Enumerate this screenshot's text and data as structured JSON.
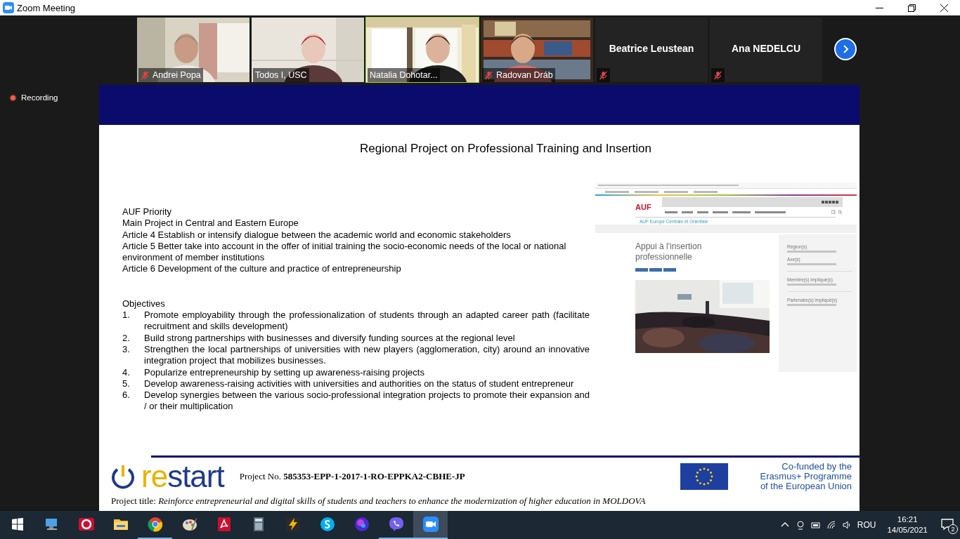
{
  "window": {
    "title": "Zoom Meeting"
  },
  "tiles": [
    {
      "kind": "video",
      "name": "Andrei Popa",
      "muted": true,
      "speaking": false
    },
    {
      "kind": "video",
      "name": "Todos I, USC",
      "muted": false,
      "speaking": false
    },
    {
      "kind": "video",
      "name": "Natalia Dohotar...",
      "muted": false,
      "speaking": true
    },
    {
      "kind": "video",
      "name": "Radovan Dráb",
      "muted": true,
      "speaking": false
    },
    {
      "kind": "name",
      "name": "Beatrice Leustean",
      "muted": true,
      "speaking": false
    },
    {
      "kind": "name",
      "name": "Ana NEDELCU",
      "muted": true,
      "speaking": false
    }
  ],
  "recording": {
    "label": "Recording"
  },
  "slide": {
    "title": "Regional Project on Professional Training and Insertion",
    "priority_lines": [
      "AUF Priority",
      "Main Project in Central and Eastern Europe",
      "Article 4 Establish or intensify dialogue between the academic world and economic stakeholders",
      "Article 5 Better take into account in the offer of initial training the socio-economic needs of the local or national environment of member institutions",
      "Article 6 Development of the culture and practice of entrepreneurship"
    ],
    "objectives_heading": "Objectives",
    "objectives": [
      {
        "number": "1.",
        "text": "Promote employability through the professionalization of students through an adapted career path (facilitate recruitment and skills development)"
      },
      {
        "number": "2.",
        "text": "Build strong partnerships with businesses and diversify funding sources at the regional level"
      },
      {
        "number": "3.",
        "text": "Strengthen the local partnerships of universities with new players (agglomeration, city) around an innovative integration project that mobilizes businesses."
      },
      {
        "number": "4.",
        "text": "Popularize entrepreneurship by setting up awareness-raising projects"
      },
      {
        "number": "5.",
        "text": "Develop awareness-raising activities with universities and authorities on the status of student entrepreneur"
      },
      {
        "number": "6.",
        "text": "Develop synergies between the various socio-professional integration projects to promote their expansion and / or their multiplication"
      }
    ],
    "website": {
      "logo": "AUF",
      "region": "AUF Europe Centrale et Orientale",
      "title": "Appui à l'insertion professionnelle",
      "sidebar": [
        {
          "kind": "heading",
          "text": "Région(s)"
        },
        {
          "kind": "heading",
          "text": "Axe(s)"
        },
        {
          "kind": "rule"
        },
        {
          "kind": "heading",
          "text": "Membre(s) impliqué(s)"
        },
        {
          "kind": "rule"
        },
        {
          "kind": "heading",
          "text": "Partenaire(s) impliqué(s)"
        }
      ]
    },
    "footer": {
      "logo_prefix": "re",
      "logo_main": "start",
      "project_no": "Project No. **585353-EPP-1-2017-1-RO-EPPKA2-CBHE-JP**",
      "project_title": "Project title: *Reinforce entrepreneurial and digital skills of students and teachers to enhance the modernization of higher education in MOLDOVA*",
      "cofunded": [
        "Co-funded by the",
        "Erasmus+ Programme",
        "of the European Union"
      ]
    }
  },
  "taskbar": {
    "apps": [
      {
        "kind": "monitor",
        "running": false,
        "selected": false
      },
      {
        "kind": "red-ring",
        "running": false,
        "selected": false
      },
      {
        "kind": "folder",
        "running": false,
        "selected": false
      },
      {
        "kind": "browser",
        "running": true,
        "selected": false
      },
      {
        "kind": "palette",
        "running": false,
        "selected": false
      },
      {
        "kind": "pdf",
        "running": false,
        "selected": false
      },
      {
        "kind": "calculator",
        "running": false,
        "selected": false
      },
      {
        "kind": "bolt",
        "running": false,
        "selected": false
      },
      {
        "kind": "s-app",
        "running": false,
        "selected": false
      },
      {
        "kind": "orb",
        "running": false,
        "selected": false
      },
      {
        "kind": "phone-bubble",
        "running": true,
        "selected": false
      },
      {
        "kind": "camera",
        "running": true,
        "selected": true
      }
    ],
    "language": "ROU",
    "time": "16:21",
    "date": "14/05/2021",
    "notifications": "2"
  }
}
